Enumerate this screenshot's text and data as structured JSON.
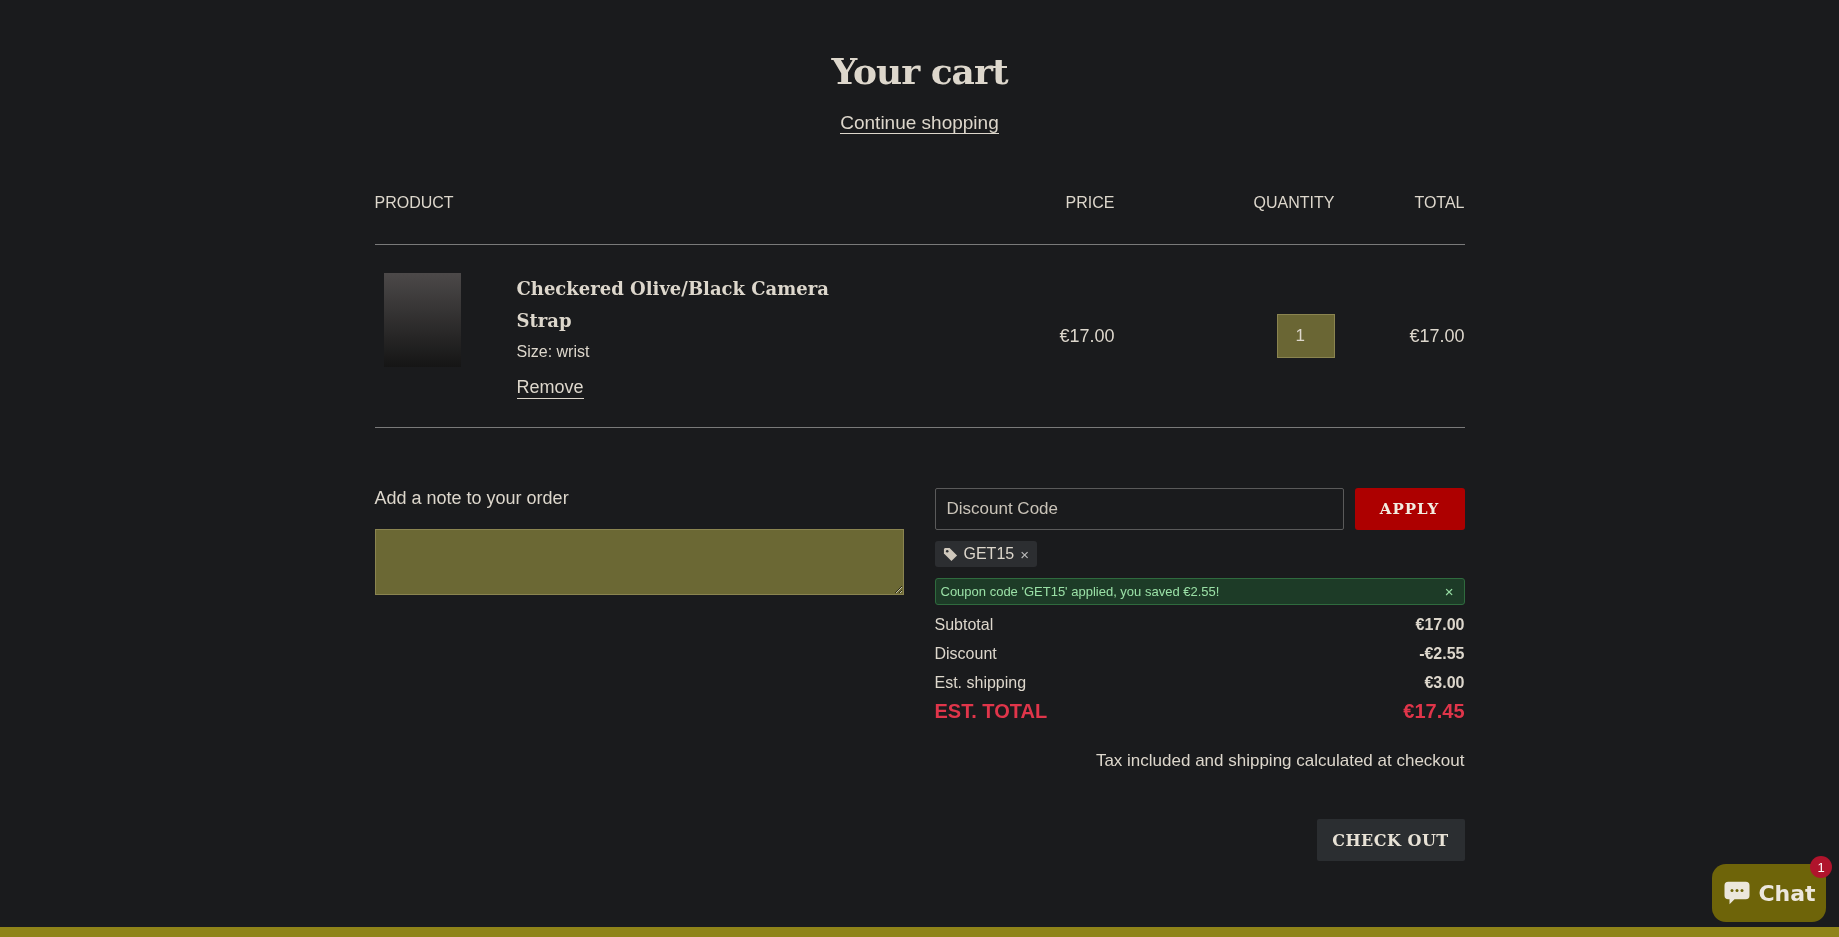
{
  "title": "Your cart",
  "continue_link": "Continue shopping",
  "table": {
    "columns": [
      "PRODUCT",
      "PRICE",
      "QUANTITY",
      "TOTAL"
    ],
    "rows": [
      {
        "name": "Checkered Olive/Black Camera Strap",
        "variant": "Size: wrist",
        "remove": "Remove",
        "price": "€17.00",
        "quantity": "1",
        "total": "€17.00"
      }
    ]
  },
  "note": {
    "label": "Add a note to your order"
  },
  "discount": {
    "placeholder": "Discount Code",
    "button": "APPLY",
    "tags": [
      {
        "code": "GET15",
        "remove": "×"
      }
    ],
    "message": {
      "text": "Coupon code 'GET15' applied, you saved €2.55!",
      "close": "×"
    }
  },
  "summary": [
    {
      "label": "Subtotal",
      "value": "€17.00",
      "kind": "line"
    },
    {
      "label": "Discount",
      "value": "-€2.55",
      "kind": "line"
    },
    {
      "label": "Est. shipping",
      "value": "€3.00",
      "kind": "line"
    },
    {
      "label": "EST. TOTAL",
      "value": "€17.45",
      "kind": "total"
    }
  ],
  "tax_note": "Tax included and shipping calculated at checkout",
  "checkout": "CHECK OUT",
  "chat": {
    "label": "Chat",
    "badge": "1"
  }
}
